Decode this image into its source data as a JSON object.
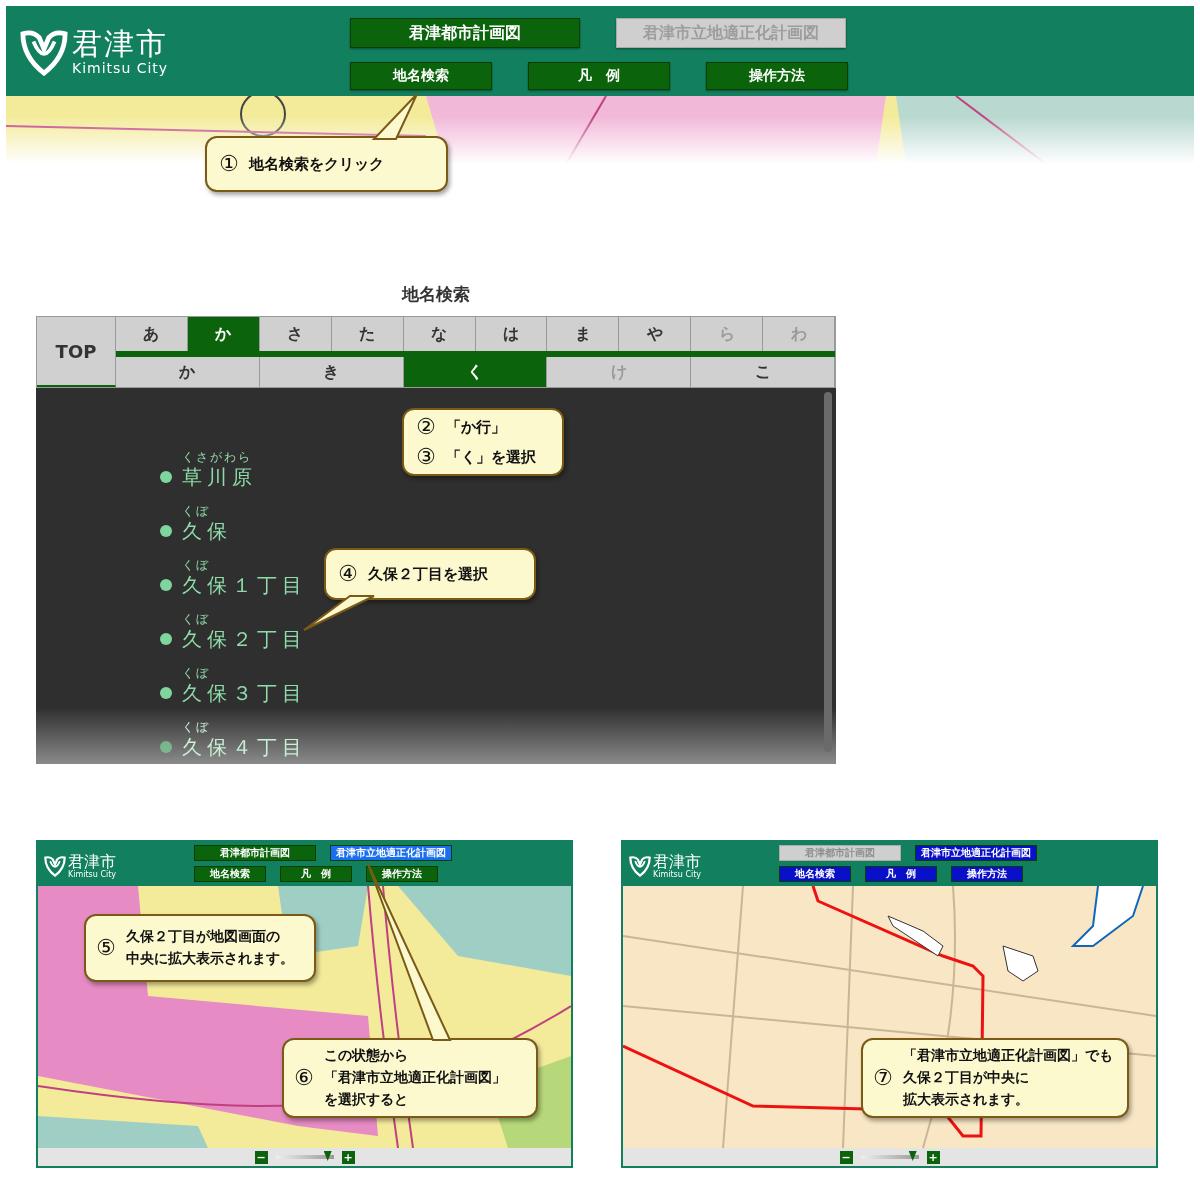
{
  "header": {
    "logo": {
      "name": "君津市",
      "sub": "Kimitsu City"
    },
    "map_buttons": [
      {
        "label": "君津都市計画図",
        "disabled": false,
        "color": "#0b640b"
      },
      {
        "label": "君津市立地適正化計画図",
        "disabled": true,
        "color": "#cfcfcf"
      }
    ],
    "tool_buttons": [
      {
        "label": "地名検索",
        "disabled": false,
        "color": "#0b640b"
      },
      {
        "label": "凡　例",
        "disabled": false,
        "color": "#0b640b"
      },
      {
        "label": "操作方法",
        "disabled": false,
        "color": "#0b640b"
      }
    ]
  },
  "callout_1": {
    "items": [
      {
        "number": "①",
        "lines": [
          "地名検索をクリック"
        ]
      }
    ]
  },
  "search_panel": {
    "title": "地名検索",
    "top_button": "TOP",
    "row_tabs": [
      {
        "label": "あ",
        "selected": false,
        "disabled": false
      },
      {
        "label": "か",
        "selected": true,
        "disabled": false
      },
      {
        "label": "さ",
        "selected": false,
        "disabled": false
      },
      {
        "label": "た",
        "selected": false,
        "disabled": false
      },
      {
        "label": "な",
        "selected": false,
        "disabled": false
      },
      {
        "label": "は",
        "selected": false,
        "disabled": false
      },
      {
        "label": "ま",
        "selected": false,
        "disabled": false
      },
      {
        "label": "や",
        "selected": false,
        "disabled": false
      },
      {
        "label": "ら",
        "selected": false,
        "disabled": true
      },
      {
        "label": "わ",
        "selected": false,
        "disabled": true
      }
    ],
    "kana_tabs": [
      {
        "label": "か",
        "selected": false,
        "disabled": false
      },
      {
        "label": "き",
        "selected": false,
        "disabled": false
      },
      {
        "label": "く",
        "selected": true,
        "disabled": false
      },
      {
        "label": "け",
        "selected": false,
        "disabled": true
      },
      {
        "label": "こ",
        "selected": false,
        "disabled": false
      }
    ],
    "results": [
      {
        "reading": "くさがわら",
        "name": "草川原"
      },
      {
        "reading": "くぼ",
        "name": "久保"
      },
      {
        "reading": "くぼ",
        "name": "久保１丁目"
      },
      {
        "reading": "くぼ",
        "name": "久保２丁目"
      },
      {
        "reading": "くぼ",
        "name": "久保３丁目"
      },
      {
        "reading": "くぼ",
        "name": "久保４丁目"
      }
    ],
    "callout_2": {
      "items": [
        {
          "number": "②",
          "lines": [
            "「か行」"
          ]
        },
        {
          "number": "③",
          "lines": [
            "「く」を選択"
          ]
        }
      ]
    },
    "callout_3": {
      "items": [
        {
          "number": "④",
          "lines": [
            "久保２丁目を選択"
          ]
        }
      ]
    }
  },
  "screens": [
    {
      "kind": "zoning",
      "logo": {
        "name": "君津市",
        "sub": "Kimitsu City"
      },
      "map_buttons": [
        {
          "label": "君津都市計画図",
          "disabled": false,
          "color": "#0b640b"
        },
        {
          "label": "君津市立地適正化計画図",
          "disabled": false,
          "color": "#1a6ff0"
        }
      ],
      "tool_buttons": [
        {
          "label": "地名検索",
          "disabled": false,
          "color": "#0b640b"
        },
        {
          "label": "凡　例",
          "disabled": false,
          "color": "#0b640b"
        },
        {
          "label": "操作方法",
          "disabled": false,
          "color": "#0b640b"
        }
      ],
      "callouts": [
        {
          "number": "⑤",
          "lines": [
            "久保２丁目が地図画面の",
            "中央に拡大表示されます。"
          ]
        },
        {
          "number": "⑥",
          "lines": [
            "この状態から",
            "「君津市立地適正化計画図」",
            "を選択すると"
          ]
        }
      ],
      "zoom": {
        "minus": "−",
        "plus": "+",
        "level": 0.9
      }
    },
    {
      "kind": "basemap",
      "logo": {
        "name": "君津市",
        "sub": "Kimitsu City"
      },
      "map_buttons": [
        {
          "label": "君津都市計画図",
          "disabled": true,
          "color": "#cfcfcf"
        },
        {
          "label": "君津市立地適正化計画図",
          "disabled": false,
          "color": "#0a10c8"
        }
      ],
      "tool_buttons": [
        {
          "label": "地名検索",
          "disabled": false,
          "color": "#0a10c8"
        },
        {
          "label": "凡　例",
          "disabled": false,
          "color": "#0a10c8"
        },
        {
          "label": "操作方法",
          "disabled": false,
          "color": "#0a10c8"
        }
      ],
      "callouts": [
        {
          "number": "⑦",
          "lines": [
            "「君津市立地適正化計画図」でも",
            "久保２丁目が中央に",
            "拡大表示されます。"
          ]
        }
      ],
      "zoom": {
        "minus": "−",
        "plus": "+",
        "level": 0.9
      }
    }
  ]
}
